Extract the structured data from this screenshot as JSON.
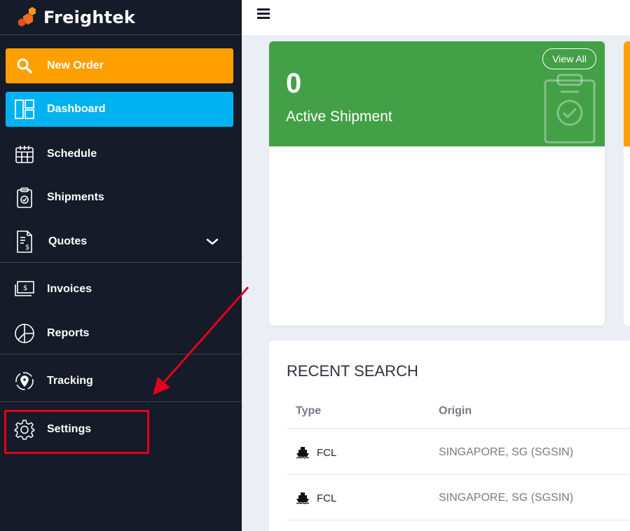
{
  "brand": {
    "name": "Freightek"
  },
  "sidebar": {
    "items": [
      {
        "label": "New Order",
        "icon": "search-icon"
      },
      {
        "label": "Dashboard",
        "icon": "dashboard-icon"
      },
      {
        "label": "Schedule",
        "icon": "calendar-icon"
      },
      {
        "label": "Shipments",
        "icon": "clipboard-icon"
      },
      {
        "label": "Quotes",
        "icon": "document-dollar-icon"
      },
      {
        "label": "Invoices",
        "icon": "money-icon"
      },
      {
        "label": "Reports",
        "icon": "pie-chart-icon"
      },
      {
        "label": "Tracking",
        "icon": "location-icon"
      },
      {
        "label": "Settings",
        "icon": "gear-icon"
      }
    ]
  },
  "card": {
    "count": "0",
    "title": "Active Shipment",
    "view_all": "View All"
  },
  "recent_search": {
    "title": "RECENT SEARCH",
    "columns": [
      "Type",
      "Origin"
    ],
    "rows": [
      {
        "type": "FCL",
        "origin": "SINGAPORE, SG (SGSIN)"
      },
      {
        "type": "FCL",
        "origin": "SINGAPORE, SG (SGSIN)"
      }
    ]
  },
  "colors": {
    "sidebar_bg": "#151b29",
    "new_order": "#ff9f00",
    "dashboard": "#00b3f0",
    "card_green": "#43a047",
    "highlight": "#e3001b"
  }
}
